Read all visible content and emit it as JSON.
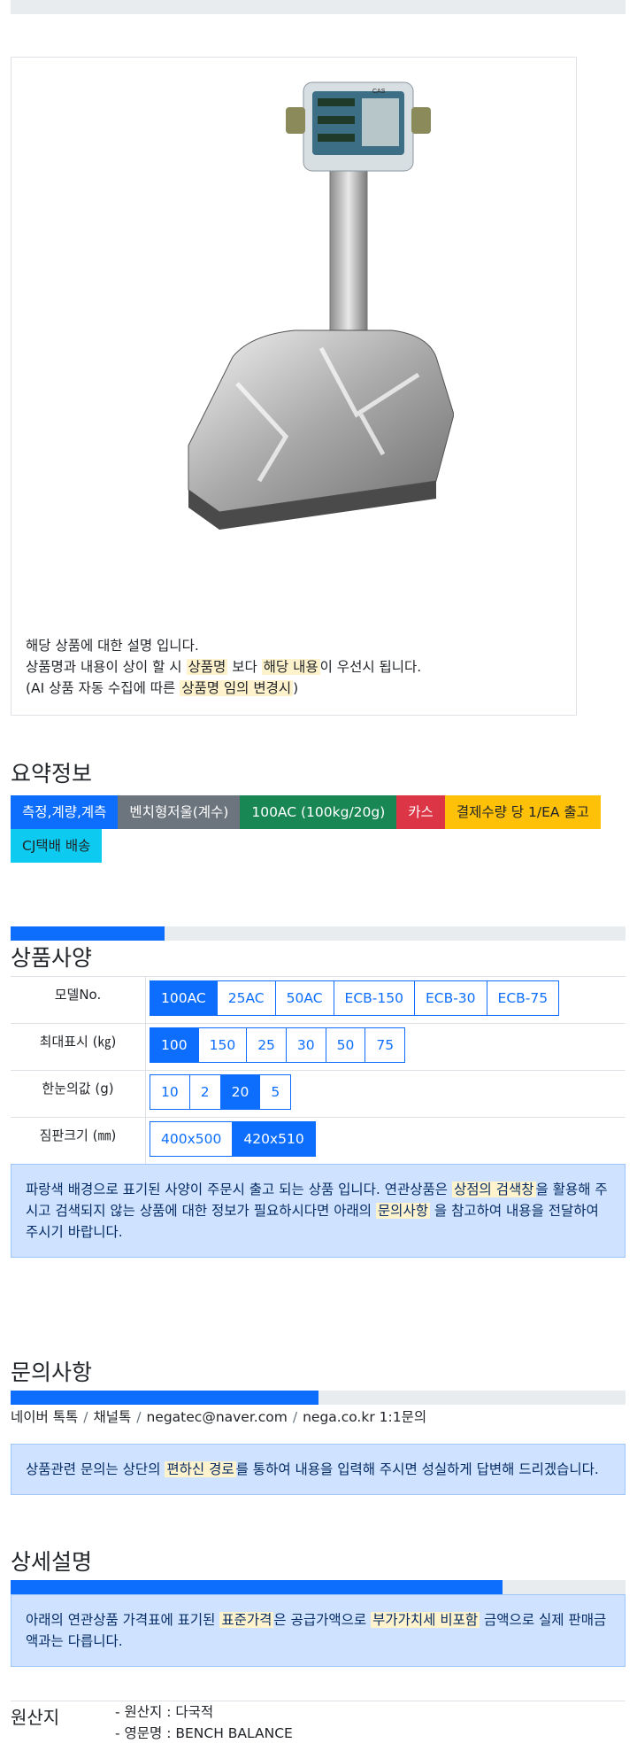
{
  "product": {
    "image_desc_line1": "해당 상품에 대한 설명 입니다.",
    "image_desc_line2_a": "상품명과 내용이 상이 할 시 ",
    "image_desc_line2_hl1": "상품명",
    "image_desc_line2_b": " 보다 ",
    "image_desc_line2_hl2": "해당 내용",
    "image_desc_line2_c": "이 우선시 됩니다.",
    "image_desc_line3_a": "(AI 상품 자동 수집에 따른 ",
    "image_desc_line3_hl": "상품명 임의 변경시",
    "image_desc_line3_b": ")",
    "image_brand": "CAS"
  },
  "summary": {
    "title": "요약정보",
    "badges": [
      "측정,계량,계측",
      "벤치형저울(계수)",
      "100AC (100kg/20g)",
      "카스",
      "결제수량 당 1/EA 출고",
      "CJ택배 배송"
    ]
  },
  "spec": {
    "title": "상품사양",
    "progress": 0.25,
    "rows": [
      {
        "label": "모델No.",
        "options": [
          "100AC",
          "25AC",
          "50AC",
          "ECB-150",
          "ECB-30",
          "ECB-75"
        ],
        "selected": 0
      },
      {
        "label": "최대표시 (㎏)",
        "options": [
          "100",
          "150",
          "25",
          "30",
          "50",
          "75"
        ],
        "selected": 0
      },
      {
        "label": "한눈의값 (g)",
        "options": [
          "10",
          "2",
          "20",
          "5"
        ],
        "selected": 2
      },
      {
        "label": "짐판크기 (㎜)",
        "options": [
          "400x500",
          "420x510"
        ],
        "selected": 1
      }
    ],
    "notice_a": "파랑색 배경으로 표기된 사양이 주문시 출고 되는 상품 입니다. 연관상품은 ",
    "notice_hl1": "상점의 검색창",
    "notice_b": "을 활용해 주시고 검색되지 않는 상품에 대한 정보가 필요하시다면 아래의 ",
    "notice_hl2": "문의사항",
    "notice_c": " 을 참고하여 내용을 전달하여 주시기 바랍니다."
  },
  "inquiry": {
    "title": "문의사항",
    "progress": 0.5,
    "links": [
      "네이버 톡톡",
      "채널톡",
      "negatec@naver.com",
      "nega.co.kr 1:1문의"
    ],
    "notice_a": "상품관련 문의는 상단의 ",
    "notice_hl": "편하신 경로",
    "notice_b": "를 통하여 내용을 입력해 주시면 성실하게 답변해 드리겠습니다."
  },
  "detail": {
    "title": "상세설명",
    "progress": 0.8,
    "notice_a": "아래의 연관상품 가격표에 표기된 ",
    "notice_hl1": "표준가격",
    "notice_b": "은 공급가액으로 ",
    "notice_hl2": "부가가치세 비포함",
    "notice_c": " 금액으로 실제 판매금액과는 다릅니다."
  },
  "origin": {
    "label": "원산지",
    "line1": "- 원산지 : 다국적",
    "line2": "- 영문명 : BENCH BALANCE"
  },
  "colors": {
    "primary": "#0d6efd",
    "highlight": "#fff3cd",
    "info_bg": "#cfe2ff"
  }
}
